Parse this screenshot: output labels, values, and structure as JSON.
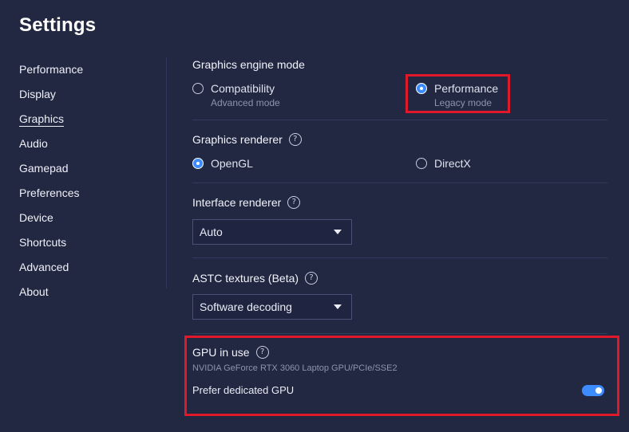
{
  "page": {
    "title": "Settings"
  },
  "sidebar": {
    "items": [
      {
        "label": "Performance",
        "active": false
      },
      {
        "label": "Display",
        "active": false
      },
      {
        "label": "Graphics",
        "active": true
      },
      {
        "label": "Audio",
        "active": false
      },
      {
        "label": "Gamepad",
        "active": false
      },
      {
        "label": "Preferences",
        "active": false
      },
      {
        "label": "Device",
        "active": false
      },
      {
        "label": "Shortcuts",
        "active": false
      },
      {
        "label": "Advanced",
        "active": false
      },
      {
        "label": "About",
        "active": false
      }
    ]
  },
  "graphics_engine_mode": {
    "title": "Graphics engine mode",
    "options": [
      {
        "label": "Compatibility",
        "sublabel": "Advanced mode",
        "selected": false
      },
      {
        "label": "Performance",
        "sublabel": "Legacy mode",
        "selected": true
      }
    ]
  },
  "graphics_renderer": {
    "title": "Graphics renderer",
    "help_icon": "?",
    "options": [
      {
        "label": "OpenGL",
        "selected": true
      },
      {
        "label": "DirectX",
        "selected": false
      }
    ]
  },
  "interface_renderer": {
    "title": "Interface renderer",
    "help_icon": "?",
    "selected": "Auto"
  },
  "astc_textures": {
    "title": "ASTC textures (Beta)",
    "help_icon": "?",
    "selected": "Software decoding"
  },
  "gpu": {
    "title": "GPU in use",
    "help_icon": "?",
    "name": "NVIDIA GeForce RTX 3060 Laptop GPU/PCIe/SSE2",
    "prefer_dedicated_label": "Prefer dedicated GPU",
    "prefer_dedicated_on": true
  },
  "colors": {
    "background": "#232842",
    "accent": "#3d8cff",
    "highlight": "#e0182a"
  }
}
